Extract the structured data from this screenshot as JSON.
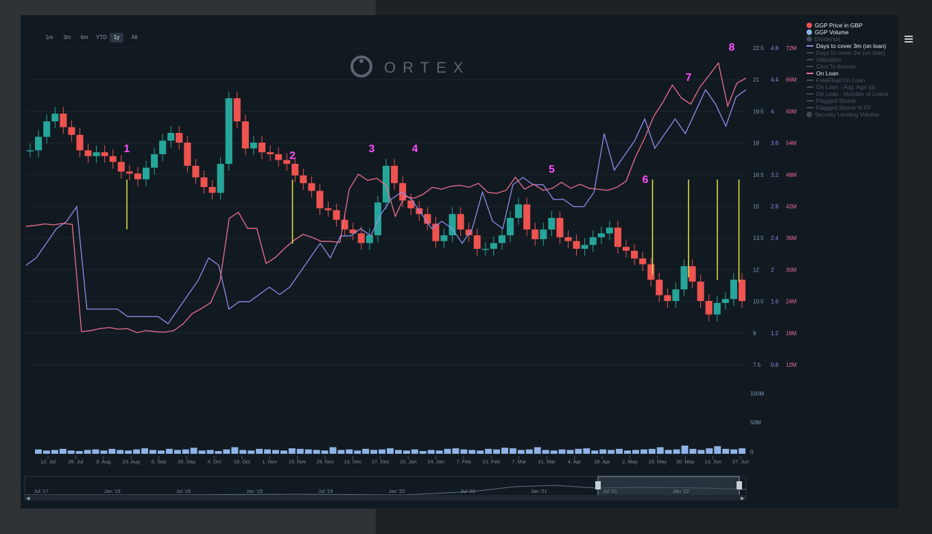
{
  "range_buttons": [
    "1m",
    "3m",
    "6m",
    "YTD",
    "1y",
    "All"
  ],
  "active_range": "1y",
  "logo_text": "ORTEX",
  "chart_data": {
    "type": "line",
    "title": "",
    "x_ticks": [
      "12. Jul",
      "26. Jul",
      "9. Aug",
      "23. Aug",
      "6. Sep",
      "20. Sep",
      "4. Oct",
      "18. Oct",
      "1. Nov",
      "15. Nov",
      "29. Nov",
      "13. Dec",
      "27. Dec",
      "10. Jan",
      "24. Jan",
      "7. Feb",
      "21. Feb",
      "7. Mar",
      "21. Mar",
      "4. Apr",
      "18. Apr",
      "2. May",
      "16. May",
      "30. May",
      "13. Jun",
      "27. Jun"
    ],
    "axis_price_ticks": [
      "22.5",
      "21",
      "19.5",
      "18",
      "16.5",
      "15",
      "13.5",
      "12",
      "10.5",
      "9",
      "7.5"
    ],
    "axis_days_ticks": [
      "4.8",
      "4.4",
      "4",
      "3.6",
      "3.2",
      "2.8",
      "2.4",
      "2",
      "1.6",
      "1.2",
      "0.8"
    ],
    "axis_onloan_ticks": [
      "72M",
      "66M",
      "60M",
      "54M",
      "48M",
      "42M",
      "36M",
      "30M",
      "24M",
      "18M",
      "12M"
    ],
    "volume_ticks": [
      "100M",
      "50M",
      "0"
    ],
    "price_range": [
      6.8,
      23.2
    ],
    "volume_max": 125,
    "annotations": [
      "1",
      "2",
      "3",
      "4",
      "5",
      "6",
      "7",
      "8"
    ],
    "series": [
      {
        "name": "GGP Price in GBP",
        "color": "#ef5350",
        "values": [
          17.9,
          18.6,
          19.4,
          19.8,
          19.1,
          18.7,
          17.9,
          17.6,
          17.8,
          17.6,
          17.3,
          16.8,
          16.7,
          16.4,
          17.0,
          17.7,
          18.4,
          18.8,
          18.3,
          17.1,
          16.5,
          16.0,
          15.7,
          17.2,
          20.6,
          19.4,
          18.0,
          18.3,
          17.8,
          17.7,
          17.4,
          17.2,
          16.6,
          16.2,
          15.8,
          14.9,
          14.8,
          14.3,
          13.8,
          13.6,
          13.1,
          13.5,
          15.2,
          17.1,
          16.2,
          15.3,
          14.9,
          14.6,
          14.1,
          13.2,
          13.5,
          14.6,
          13.8,
          13.5,
          12.8,
          12.8,
          13.1,
          13.5,
          14.4,
          15.1,
          13.8,
          13.3,
          13.8,
          14.4,
          13.4,
          13.2,
          12.8,
          13.0,
          13.4,
          13.6,
          13.9,
          12.9,
          12.7,
          12.3,
          12.0,
          11.2,
          10.4,
          10.1,
          10.7,
          11.9,
          11.1,
          10.1,
          9.4,
          10.0,
          10.2,
          11.2,
          10.1
        ]
      },
      {
        "name": "GGP Volume",
        "color": "#8fb3e6",
        "values": [
          8,
          6,
          7,
          9,
          6,
          5,
          7,
          8,
          6,
          9,
          7,
          6,
          8,
          10,
          7,
          6,
          9,
          7,
          8,
          11,
          6,
          7,
          5,
          8,
          12,
          7,
          6,
          9,
          8,
          7,
          6,
          10,
          9,
          8,
          7,
          6,
          12,
          7,
          8,
          6,
          9,
          7,
          8,
          10,
          7,
          6,
          8,
          5,
          7,
          6,
          9,
          10,
          8,
          7,
          6,
          9,
          8,
          11,
          10,
          7,
          8,
          12,
          7,
          6,
          8,
          7,
          9,
          10,
          6,
          8,
          7,
          9,
          6,
          7,
          8,
          9,
          12,
          7,
          8,
          15,
          9,
          7,
          10,
          14,
          9,
          8,
          10
        ]
      },
      {
        "name": "Days to cover 3m (on loan)",
        "color": "#8f8ff0",
        "values": [
          2.0,
          2.1,
          2.3,
          2.5,
          2.6,
          2.8,
          1.4,
          1.4,
          1.4,
          1.4,
          1.3,
          1.3,
          1.3,
          1.3,
          1.2,
          1.4,
          1.6,
          1.8,
          2.1,
          2.0,
          1.4,
          1.5,
          1.5,
          1.6,
          1.7,
          1.6,
          1.7,
          1.9,
          2.1,
          2.3,
          2.1,
          2.4,
          2.4,
          2.5,
          2.4,
          2.7,
          2.9,
          3.0,
          2.9,
          2.7,
          2.5,
          2.6,
          2.5,
          2.3,
          2.5,
          3.0,
          2.6,
          2.5,
          3.1,
          3.2,
          3.1,
          3.1,
          2.9,
          2.9,
          2.8,
          2.8,
          3.0,
          3.8,
          3.3,
          3.5,
          3.7,
          4.0,
          3.6,
          3.8,
          4.0,
          3.8,
          4.1,
          4.4,
          4.2,
          3.9,
          4.3,
          4.4
        ]
      },
      {
        "name": "On Loan",
        "color": "#f07090",
        "values": [
          38,
          38.2,
          38.5,
          38.3,
          38.6,
          38.4,
          17,
          17.2,
          17.6,
          17.8,
          17.5,
          17.6,
          16.8,
          17.2,
          17.0,
          16.9,
          17.2,
          18.5,
          20.6,
          21.6,
          22.8,
          27,
          39.6,
          40.8,
          37.6,
          37.6,
          30.6,
          31.8,
          33.6,
          35.2,
          36.4,
          35.8,
          35.0,
          35.0,
          34.8,
          45.4,
          48.4,
          47.2,
          47.6,
          46.2,
          40.0,
          44.0,
          43.6,
          44.4,
          45.8,
          45.4,
          46.0,
          46.2,
          45.8,
          46.6,
          44.8,
          44.6,
          45.2,
          47.8,
          45.4,
          46.4,
          45.2,
          45.6,
          46.8,
          45.6,
          46.4,
          45.6,
          45.4,
          45.2,
          45.8,
          47.0,
          51.8,
          55.6,
          60.0,
          62.8,
          66.2,
          63.6,
          62.4,
          65.8,
          68.2,
          70.6,
          62.0,
          66.6,
          67.6
        ]
      }
    ],
    "legend": [
      {
        "label": "GGP Price in GBP",
        "kind": "dot",
        "color": "#ef5350",
        "state": "on"
      },
      {
        "label": "GGP Volume",
        "kind": "dot",
        "color": "#8fb3e6",
        "state": "on"
      },
      {
        "label": "Dividends",
        "kind": "dot",
        "color": "#3f4a55",
        "state": "off"
      },
      {
        "label": "Days to cover 3m (on loan)",
        "kind": "line",
        "color": "#8f8ff0",
        "state": "on"
      },
      {
        "label": "Days to cover 2w (on loan)",
        "kind": "line",
        "color": "#3f4a55",
        "state": "off"
      },
      {
        "label": "Utilization",
        "kind": "line",
        "color": "#3f4a55",
        "state": "off"
      },
      {
        "label": "Cost To Borrow",
        "kind": "line",
        "color": "#3f4a55",
        "state": "off"
      },
      {
        "label": "On Loan",
        "kind": "line",
        "color": "#f07090",
        "state": "on"
      },
      {
        "label": "FreeFloat On Loan",
        "kind": "line",
        "color": "#3f4a55",
        "state": "off"
      },
      {
        "label": "On Loan - Avg. Age (d)",
        "kind": "line",
        "color": "#3f4a55",
        "state": "off"
      },
      {
        "label": "On Loan - Number of Loans",
        "kind": "line",
        "color": "#3f4a55",
        "state": "off"
      },
      {
        "label": "Flagged Shorts",
        "kind": "line",
        "color": "#3f4a55",
        "state": "off"
      },
      {
        "label": "Flagged Shorts % FF",
        "kind": "line",
        "color": "#3f4a55",
        "state": "off"
      },
      {
        "label": "Security Lending Volume",
        "kind": "dot",
        "color": "#3f4a55",
        "state": "off"
      }
    ],
    "navigator_ticks": [
      "Jul '17",
      "Jan '18",
      "Jul '18",
      "Jan '19",
      "Jul '19",
      "Jan '20",
      "Jul '20",
      "Jan '21",
      "Jul '21",
      "Jan '22"
    ]
  },
  "colors": {
    "up": "#26a69a",
    "down": "#ef5350",
    "annotation": "#ff4dff",
    "marker": "#e8e84a"
  }
}
